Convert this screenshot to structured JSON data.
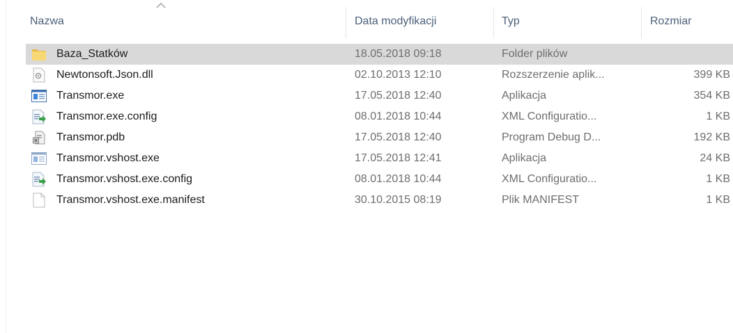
{
  "columns": {
    "name": "Nazwa",
    "date": "Data modyfikacji",
    "type": "Typ",
    "size": "Rozmiar"
  },
  "sort": {
    "column": "name",
    "icon": "chevron-up-icon"
  },
  "files": [
    {
      "name": "Baza_Statków",
      "date": "18.05.2018 09:18",
      "type": "Folder plików",
      "size": "",
      "icon": "folder-icon",
      "selected": true
    },
    {
      "name": "Newtonsoft.Json.dll",
      "date": "02.10.2013 12:10",
      "type": "Rozszerzenie aplik...",
      "size": "399 KB",
      "icon": "dll-file-icon"
    },
    {
      "name": "Transmor.exe",
      "date": "17.05.2018 12:40",
      "type": "Aplikacja",
      "size": "354 KB",
      "icon": "exe-app-icon"
    },
    {
      "name": "Transmor.exe.config",
      "date": "08.01.2018 10:44",
      "type": "XML Configuratio...",
      "size": "1 KB",
      "icon": "config-file-icon"
    },
    {
      "name": "Transmor.pdb",
      "date": "17.05.2018 12:40",
      "type": "Program Debug D...",
      "size": "192 KB",
      "icon": "pdb-file-icon"
    },
    {
      "name": "Transmor.vshost.exe",
      "date": "17.05.2018 12:41",
      "type": "Aplikacja",
      "size": "24 KB",
      "icon": "exe-app-icon"
    },
    {
      "name": "Transmor.vshost.exe.config",
      "date": "08.01.2018 10:44",
      "type": "XML Configuratio...",
      "size": "1 KB",
      "icon": "config-file-icon"
    },
    {
      "name": "Transmor.vshost.exe.manifest",
      "date": "30.10.2015 08:19",
      "type": "Plik MANIFEST",
      "size": "1 KB",
      "icon": "blank-file-icon"
    }
  ],
  "colors": {
    "header_text": "#4c607a",
    "selected_row": "#d9d9d9",
    "folder": "#f8d775"
  }
}
